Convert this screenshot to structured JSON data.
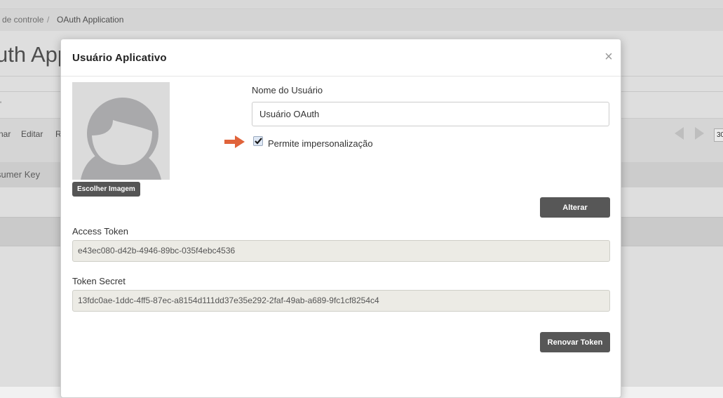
{
  "background": {
    "breadcrumb": [
      "de controle",
      "/",
      "OAuth Application"
    ],
    "page_heading": "uth App",
    "tick_text": "'",
    "toolbar": [
      "nar",
      "Editar",
      "R"
    ],
    "page_size": "30",
    "column_header": "sumer Key"
  },
  "modal": {
    "title": "Usuário Aplicativo",
    "close": "×",
    "choose_image_label": "Escolher Imagem",
    "username_label": "Nome do Usuário",
    "username_value": "Usuário OAuth",
    "impersonation_label": "Permite impersonalização",
    "impersonation_checked": true,
    "alterar_label": "Alterar",
    "access_token_label": "Access Token",
    "access_token_value": "e43ec080-d42b-4946-89bc-035f4ebc4536",
    "token_secret_label": "Token Secret",
    "token_secret_value": "13fdc0ae-1ddc-4ff5-87ec-a8154d111dd37e35e292-2faf-49ab-a689-9fc1cf8254c4",
    "renew_label": "Renovar Token"
  },
  "colors": {
    "arrow": "#e0633a",
    "button": "#575757",
    "readonly_field": "#ecebe5",
    "avatar_bg": "#dbdbdb",
    "avatar_figure": "#a9a9ab"
  }
}
